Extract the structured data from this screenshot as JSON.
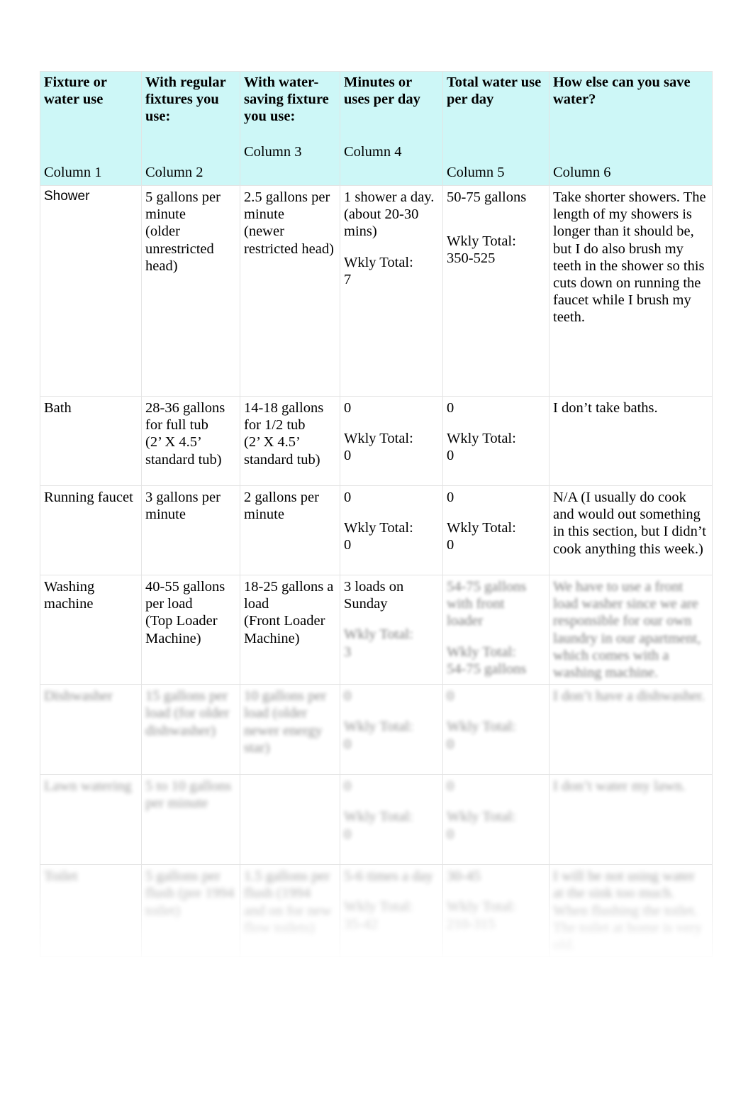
{
  "document": {
    "type": "water-use-tracking-table",
    "header_background": "#cdf7f7"
  },
  "table": {
    "columns": [
      {
        "title": "Fixture or water use",
        "column_label": "Column 1"
      },
      {
        "title": "With regular fixtures you use:",
        "column_label": "Column 2"
      },
      {
        "title": "With water-saving fixture you use:",
        "column_label": "Column 3"
      },
      {
        "title": "Minutes or uses per day",
        "column_label": "Column 4"
      },
      {
        "title": "Total water use per day",
        "column_label": "Column 5"
      },
      {
        "title": "How else can you save water?",
        "column_label": "Column 6"
      }
    ],
    "rows": [
      {
        "fixture": "Shower",
        "regular_l1": "5 gallons per",
        "regular_l2": "minute",
        "regular_l3": "(older",
        "regular_l4": "unrestricted",
        "regular_l5": "head)",
        "saving_l1": "2.5 gallons per",
        "saving_l2": "minute",
        "saving_l3": "(newer",
        "saving_l4": "restricted head)",
        "uses_l1": " 1 shower a day.",
        "uses_l2": "(about 20-30",
        "uses_l3": "mins)",
        "uses_total_label": "Wkly Total:",
        "uses_total_value": "7",
        "total_l1": " 50-75 gallons",
        "total_total_label": "Wkly Total:",
        "total_total_value": "350-525",
        "save": "Take shorter showers. The length of my showers is longer than it should be, but I do also brush my teeth in the shower so this cuts down on running the faucet while I brush my teeth."
      },
      {
        "fixture": "Bath",
        "regular_l1": "28-36 gallons",
        "regular_l2": "for full tub",
        "regular_l3": "(2’ X 4.5’",
        "regular_l4": "standard tub)",
        "saving_l1": "14-18 gallons",
        "saving_l2": "for 1/2 tub",
        "saving_l3": "(2’ X 4.5’",
        "saving_l4": "standard tub)",
        "uses_l1": "0",
        "uses_total_label": "Wkly Total:",
        "uses_total_value": "0",
        "total_l1": " 0",
        "total_total_label": "Wkly Total:",
        "total_total_value": "0",
        "save": "I don’t take baths."
      },
      {
        "fixture": "Running faucet",
        "regular_l1": "3 gallons per",
        "regular_l2": "minute",
        "saving_l1": "2 gallons per",
        "saving_l2": "minute",
        "uses_l1": "0",
        "uses_total_label": "Wkly Total:",
        "uses_total_value": "0",
        "total_l1": " 0",
        "total_total_label": "Wkly Total:",
        "total_total_value": "0",
        "save": "N/A (I usually do cook and would out something in this section, but I didn’t cook anything this week.)"
      },
      {
        "fixture_l1": "Washing",
        "fixture_l2": "machine",
        "regular_l1": "40-55 gallons",
        "regular_l2": "per load",
        "regular_l3": "(Top Loader",
        "regular_l4": "Machine)",
        "saving_l1": "18-25 gallons a",
        "saving_l2": "load",
        "saving_l3": "(Front Loader",
        "saving_l4": "Machine)",
        "uses_l1": " 3 loads on",
        "uses_l2": "Sunday",
        "uses_total_label": "Wkly Total:",
        "uses_total_value": "3",
        "total_l1": "54-75 gallons with front",
        "total_l2": "loader",
        "total_total_label": "Wkly Total:",
        "total_total_value": "54-75 gallons",
        "save": "We have to use a front load washer since we are responsible for our own laundry in our apartment, which comes with a washing machine."
      },
      {
        "fixture": "Dishwasher",
        "regular_l1": "15 gallons per",
        "regular_l2": "load (for older",
        "regular_l3": "dishwasher)",
        "saving_l1": "10 gallons per",
        "saving_l2": "load (older",
        "saving_l3": "newer energy",
        "saving_l4": "star)",
        "uses_l1": "0",
        "uses_total_label": "Wkly Total:",
        "uses_total_value": "0",
        "total_l1": "0",
        "total_total_label": "Wkly Total:",
        "total_total_value": "0",
        "save": "I don’t have a dishwasher."
      },
      {
        "fixture": "Lawn watering",
        "regular_l1": "5 to 10 gallons",
        "regular_l2": "per minute",
        "saving_l1": "",
        "uses_l1": "0",
        "uses_total_label": "Wkly Total:",
        "uses_total_value": "0",
        "total_l1": "0",
        "total_total_label": "Wkly Total:",
        "total_total_value": "0",
        "save": "I don’t water my lawn."
      },
      {
        "fixture": "Toilet",
        "regular_l1": "5 gallons per",
        "regular_l2": "flush (pre 1994",
        "regular_l3": "toilet)",
        "saving_l1": "1.5 gallons per",
        "saving_l2": "flush (1994",
        "saving_l3": "and on for new",
        "saving_l4": "flow toilets)",
        "uses_l1": " 5-6 times a day",
        "uses_total_label": "Wkly Total:",
        "uses_total_value": "35-42",
        "total_l1": "30-45",
        "total_total_label": "Wkly Total:",
        "total_total_value": "210-315",
        "save": "I will be not using water at the sink too much. When flushing the toilet. The toilet at home is very old."
      }
    ]
  }
}
